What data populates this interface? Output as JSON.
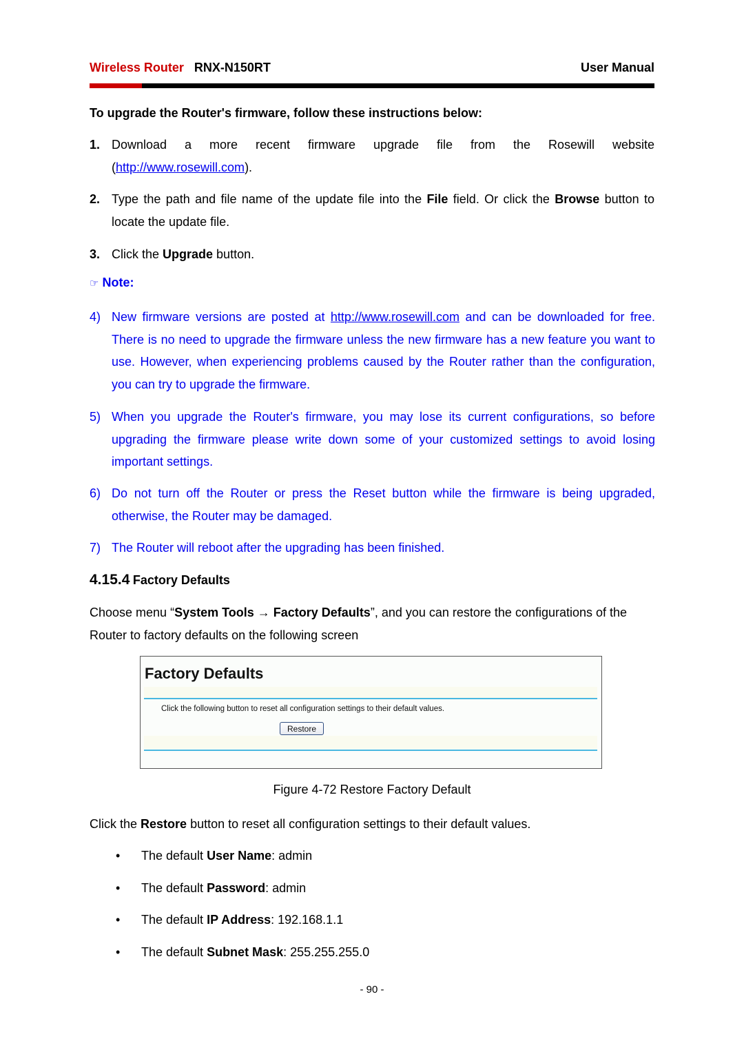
{
  "header": {
    "product_label": "Wireless Router",
    "model": "RNX-N150RT",
    "doc_type": "User Manual",
    "accent_color": "#cc0000"
  },
  "intro_heading": "To upgrade the Router's firmware, follow these instructions below:",
  "steps": [
    {
      "number": "1.",
      "line1": "Download a more recent firmware upgrade file from the Rosewill website",
      "open_paren": "(",
      "link": "http://www.rosewill.com",
      "close": ")."
    },
    {
      "number": "2.",
      "pre": "Type the path and file name of the update file into the ",
      "b1": "File",
      "mid": " field. Or click the ",
      "b2": "Browse",
      "post": " button to locate the update file."
    },
    {
      "number": "3.",
      "pre": "Click the ",
      "b1": "Upgrade",
      "post": " button."
    }
  ],
  "note": {
    "icon": "pointing-hand-icon",
    "icon_glyph": "☞",
    "label": "Note:",
    "color": "#0000ee",
    "items": [
      {
        "number": "4)",
        "pre": "New firmware versions are posted at ",
        "link": "http://www.rosewill.com",
        "post": " and can be downloaded for free. There is no need to upgrade the firmware unless the new firmware has a new feature you want to use. However, when experiencing problems caused by the Router rather than the configuration, you can try to upgrade the firmware."
      },
      {
        "number": "5)",
        "text": "When you upgrade the Router's firmware, you may lose its current configurations, so before upgrading the firmware please write down some of your customized settings to avoid losing important settings."
      },
      {
        "number": "6)",
        "text": "Do not turn off the Router or press the Reset button while the firmware is being upgraded, otherwise, the Router may be damaged."
      },
      {
        "number": "7)",
        "text": "The Router will reboot after the upgrading has been finished."
      }
    ]
  },
  "section": {
    "number": "4.15.4",
    "title": "Factory Defaults"
  },
  "menu_paragraph": {
    "pre": "Choose menu “",
    "menu_path": "System Tools → Factory Defaults",
    "post": "”, and you can restore the configurations of the Router to factory defaults on the following screen"
  },
  "figure": {
    "screen_title": "Factory Defaults",
    "description": "Click the following button to reset all configuration settings to their default values.",
    "button_label": "Restore",
    "caption": "Figure 4-72 Restore Factory Default"
  },
  "restore_paragraph": {
    "pre": "Click the ",
    "bold": "Restore",
    "post": " button to reset all configuration settings to their default values."
  },
  "defaults": [
    {
      "pre": "The default ",
      "label": "User Name",
      "value": ": admin"
    },
    {
      "pre": "The default ",
      "label": "Password",
      "value": ": admin"
    },
    {
      "pre": "The default ",
      "label": "IP Address",
      "value": ": 192.168.1.1"
    },
    {
      "pre": "The default ",
      "label": "Subnet Mask",
      "value": ": 255.255.255.0"
    }
  ],
  "bullet_glyph": "•",
  "page_number": "- 90 -"
}
